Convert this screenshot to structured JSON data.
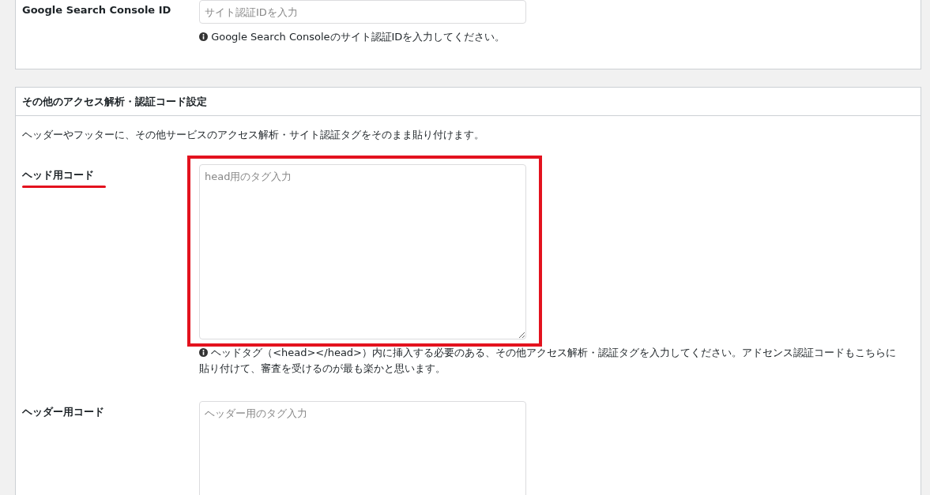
{
  "sections": [
    {
      "rows": [
        {
          "label": "Google Search Console ID",
          "placeholder": "サイト認証IDを入力",
          "multiline": false,
          "help": "Google Search Consoleのサイト認証IDを入力してください。",
          "label_underlined": false,
          "field_highlighted": false
        }
      ]
    },
    {
      "title": "その他のアクセス解析・認証コード設定",
      "description": "ヘッダーやフッターに、その他サービスのアクセス解析・サイト認証タグをそのまま貼り付けます。",
      "rows": [
        {
          "label": "ヘッド用コード",
          "placeholder": "head用のタグ入力",
          "multiline": true,
          "help": "ヘッドタグ（<head></head>）内に挿入する必要のある、その他アクセス解析・認証タグを入力してください。アドセンス認証コードもこちらに貼り付けて、審査を受けるのが最も楽かと思います。",
          "label_underlined": true,
          "field_highlighted": true
        },
        {
          "label": "ヘッダー用コード",
          "placeholder": "ヘッダー用のタグ入力",
          "multiline": true,
          "help": null,
          "label_underlined": false,
          "field_highlighted": false
        }
      ]
    }
  ]
}
